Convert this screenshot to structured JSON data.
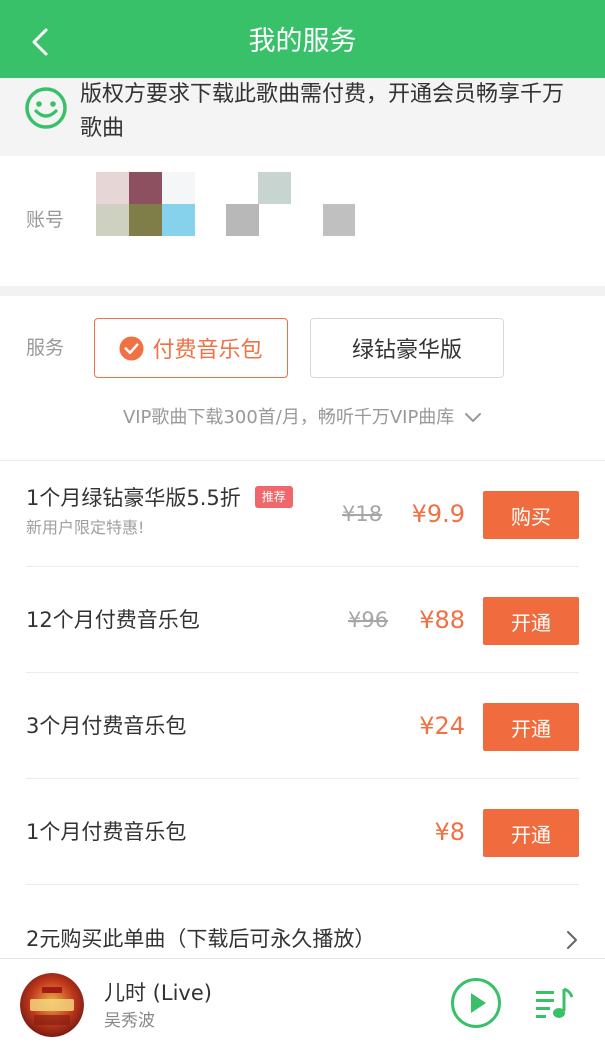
{
  "header": {
    "title": "我的服务",
    "back_icon": "chevron-left-icon"
  },
  "notice": {
    "icon": "smile-icon",
    "text_line1": "版权方要求下载此歌曲需付费，开通会员畅享千万",
    "text_line2": "歌曲"
  },
  "account": {
    "label": "账号"
  },
  "service": {
    "label": "服务",
    "options": [
      {
        "label": "付费音乐包",
        "selected": true
      },
      {
        "label": "绿钻豪华版",
        "selected": false
      }
    ],
    "description": "VIP歌曲下载300首/月，畅听千万VIP曲库"
  },
  "plans": [
    {
      "name": "1个月绿钻豪华版5.5折",
      "badge": "推荐",
      "subtitle": "新用户限定特惠!",
      "original_price": "¥18",
      "price": "¥9.9",
      "button": "购买"
    },
    {
      "name": "12个月付费音乐包",
      "original_price": "¥96",
      "price": "¥88",
      "button": "开通"
    },
    {
      "name": "3个月付费音乐包",
      "price": "¥24",
      "button": "开通"
    },
    {
      "name": "1个月付费音乐包",
      "price": "¥8",
      "button": "开通"
    }
  ],
  "single_purchase": {
    "label": "2元购买此单曲（下载后可永久播放）"
  },
  "player": {
    "song_title": "儿时 (Live)",
    "artist": "吴秀波"
  },
  "colors": {
    "brand_green": "#39c16a",
    "accent_orange": "#f07143",
    "badge_red": "#f0676b"
  }
}
